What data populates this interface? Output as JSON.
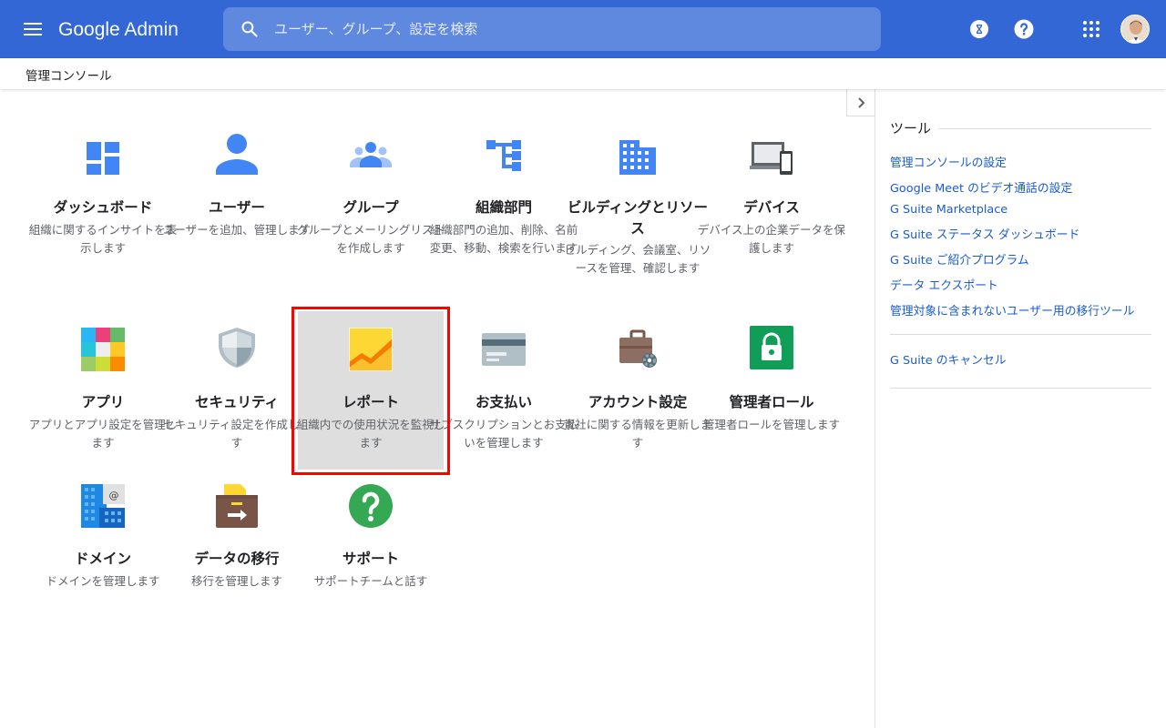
{
  "header": {
    "logo_google": "Google",
    "logo_admin": "Admin",
    "search_placeholder": "ユーザー、グループ、設定を検索",
    "bg_color": "#3367d6"
  },
  "breadcrumb": "管理コンソール",
  "tiles": [
    {
      "title": "ダッシュボード",
      "desc": "組織に関するインサイトを表示します",
      "icon": "dashboard-icon"
    },
    {
      "title": "ユーザー",
      "desc": "ユーザーを追加、管理します",
      "icon": "user-icon"
    },
    {
      "title": "グループ",
      "desc": "グループとメーリングリストを作成します",
      "icon": "group-icon"
    },
    {
      "title": "組織部門",
      "desc": "組織部門の追加、削除、名前変更、移動、検索を行います",
      "icon": "org-unit-icon"
    },
    {
      "title": "ビルディングとリソース",
      "desc": "ビルディング、会議室、リソースを管理、確認します",
      "icon": "building-icon"
    },
    {
      "title": "デバイス",
      "desc": "デバイス上の企業データを保護します",
      "icon": "devices-icon"
    },
    {
      "title": "アプリ",
      "desc": "アプリとアプリ設定を管理します",
      "icon": "apps-icon"
    },
    {
      "title": "セキュリティ",
      "desc": "セキュリティ設定を作成します",
      "icon": "shield-icon"
    },
    {
      "title": "レポート",
      "desc": "組織内での使用状況を監視します",
      "icon": "report-chart-icon"
    },
    {
      "title": "お支払い",
      "desc": "サブスクリプションとお支払いを管理します",
      "icon": "credit-card-icon"
    },
    {
      "title": "アカウント設定",
      "desc": "貴社に関する情報を更新します",
      "icon": "briefcase-gear-icon"
    },
    {
      "title": "管理者ロール",
      "desc": "管理者ロールを管理します",
      "icon": "lock-icon"
    },
    {
      "title": "ドメイン",
      "desc": "ドメインを管理します",
      "icon": "domain-icon"
    },
    {
      "title": "データの移行",
      "desc": "移行を管理します",
      "icon": "data-migration-icon"
    },
    {
      "title": "サポート",
      "desc": "サポートチームと話す",
      "icon": "help-circle-icon"
    }
  ],
  "tools": {
    "heading": "ツール",
    "links": [
      "管理コンソールの設定",
      "Google Meet のビデオ通話の設定",
      "G Suite Marketplace",
      "G Suite ステータス ダッシュボード",
      "G Suite ご紹介プログラム",
      "データ エクスポート",
      "管理対象に含まれないユーザー用の移行ツール"
    ],
    "cancel_link": "G Suite のキャンセル"
  },
  "selected_tile": "レポート",
  "colors": {
    "link": "#1a5ccf",
    "highlight_border": "#ff0000",
    "selected_bg": "#dedede"
  }
}
